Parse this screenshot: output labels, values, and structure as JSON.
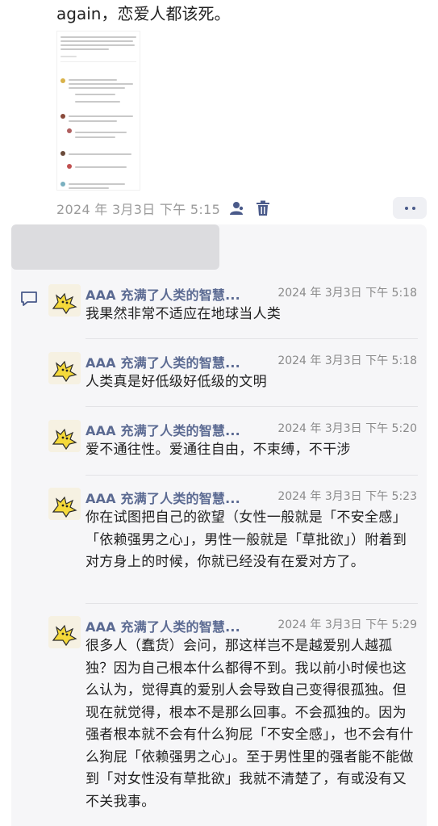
{
  "post": {
    "text_line": "again，恋爱人都该死。",
    "date": "2024 年 3月3日 下午 5:15",
    "actions": {
      "user_icon": "user-icon",
      "delete_icon": "trash-icon",
      "more_icon": "more-icon"
    }
  },
  "thread": {
    "comment_icon": "comment-icon",
    "comments": [
      {
        "name": "AAA 充满了人类的智慧...",
        "time": "2024 年 3月3日 下午 5:18",
        "text": "我果然非常不适应在地球当人类"
      },
      {
        "name": "AAA 充满了人类的智慧...",
        "time": "2024 年 3月3日 下午 5:18",
        "text": "人类真是好低级好低级的文明"
      },
      {
        "name": "AAA 充满了人类的智慧...",
        "time": "2024 年 3月3日 下午 5:20",
        "text": "爱不通往性。爱通往自由，不束缚，不干涉"
      },
      {
        "name": "AAA 充满了人类的智慧...",
        "time": "2024 年 3月3日 下午 5:23",
        "text": "你在试图把自己的欲望（女性一般就是「不安全感」「依赖强男之心」，男性一般就是「草批欲」）附着到对方身上的时候，你就已经没有在爱对方了。"
      },
      {
        "name": "AAA 充满了人类的智慧...",
        "time": "2024 年 3月3日 下午 5:29",
        "text": "很多人（蠢货）会问，那这样岂不是越爱别人越孤独？因为自己根本什么都得不到。我以前小时候也这么认为，觉得真的爱别人会导致自己变得很孤独。但现在就觉得，根本不是那么回事。不会孤独的。因为强者根本就不会有什么狗屁「不安全感」，也不会有什么狗屁「依赖强男之心」。至于男性里的强者能不能做到「对女性没有草批欲」我就不清楚了，有或没有又不关我事。"
      }
    ]
  }
}
